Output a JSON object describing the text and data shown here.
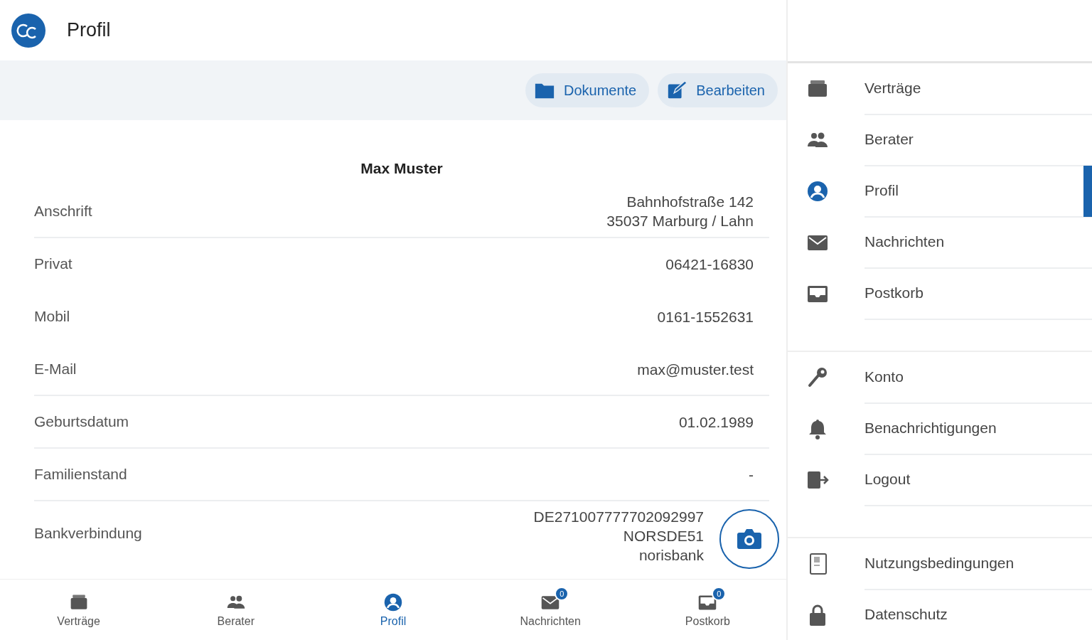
{
  "header": {
    "title": "Profil"
  },
  "toolbar": {
    "buttons": [
      {
        "kind": "folder",
        "label": "Dokumente"
      },
      {
        "kind": "edit",
        "label": "Bearbeiten"
      }
    ]
  },
  "profile": {
    "name": "Max Muster",
    "rows": [
      {
        "label": "Anschrift",
        "value": [
          "Bahnhofstraße 142",
          "35037 Marburg / Lahn"
        ],
        "divider": true
      },
      {
        "label": "Privat",
        "value": [
          "06421-16830"
        ],
        "divider": false
      },
      {
        "label": "Mobil",
        "value": [
          "0161-1552631"
        ],
        "divider": false
      },
      {
        "label": "E-Mail",
        "value": [
          "max@muster.test"
        ],
        "divider": true
      },
      {
        "label": "Geburtsdatum",
        "value": [
          "01.02.1989"
        ],
        "divider": true
      },
      {
        "label": "Familienstand",
        "value": [
          "-"
        ],
        "divider": true
      },
      {
        "label": "Bankverbindung",
        "value": [
          "DE271007777702092997",
          "NORSDE51",
          "norisbank"
        ],
        "divider": false
      }
    ]
  },
  "bottom_nav": [
    {
      "kind": "briefcase",
      "label": "Verträge",
      "selected": false
    },
    {
      "kind": "people",
      "label": "Berater",
      "selected": false
    },
    {
      "kind": "person",
      "label": "Profil",
      "selected": true
    },
    {
      "kind": "mail",
      "label": "Nachrichten",
      "selected": false,
      "badge": "0"
    },
    {
      "kind": "inbox",
      "label": "Postkorb",
      "selected": false,
      "badge": "0"
    }
  ],
  "drawer": {
    "groups": [
      [
        {
          "kind": "briefcase",
          "label": "Verträge",
          "selected": false
        },
        {
          "kind": "people",
          "label": "Berater",
          "selected": false
        },
        {
          "kind": "person",
          "label": "Profil",
          "selected": true
        },
        {
          "kind": "mail",
          "label": "Nachrichten",
          "selected": false
        },
        {
          "kind": "inbox",
          "label": "Postkorb",
          "selected": false
        }
      ],
      [
        {
          "kind": "key",
          "label": "Konto",
          "selected": false
        },
        {
          "kind": "bell",
          "label": "Benachrichtigungen",
          "selected": false
        },
        {
          "kind": "logout",
          "label": "Logout",
          "selected": false
        }
      ],
      [
        {
          "kind": "document",
          "label": "Nutzungsbedingungen",
          "selected": false
        },
        {
          "kind": "lock",
          "label": "Datenschutz",
          "selected": false
        }
      ]
    ]
  }
}
